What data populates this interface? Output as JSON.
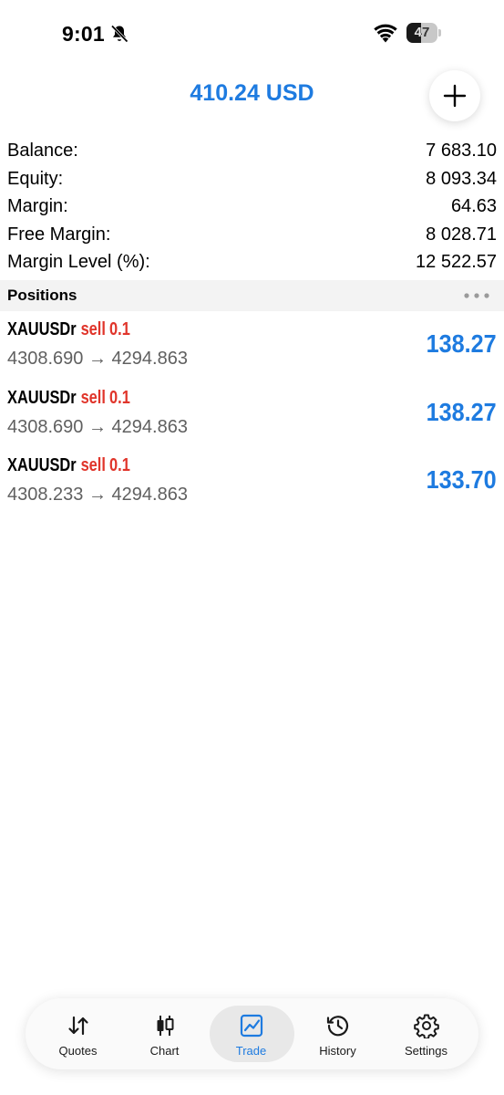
{
  "status_bar": {
    "time": "9:01",
    "battery": "47",
    "battery_level": 0.47
  },
  "header": {
    "title": "410.24 USD"
  },
  "account": [
    {
      "label": "Balance:",
      "value": "7 683.10"
    },
    {
      "label": "Equity:",
      "value": "8 093.34"
    },
    {
      "label": "Margin:",
      "value": "64.63"
    },
    {
      "label": "Free Margin:",
      "value": "8 028.71"
    },
    {
      "label": "Margin Level (%):",
      "value": "12 522.57"
    }
  ],
  "positions_section": {
    "title": "Positions"
  },
  "positions": [
    {
      "symbol": "XAUUSDr",
      "side": "sell",
      "volume": "0.1",
      "prices": "4308.690 → 4294.863",
      "profit": "138.27"
    },
    {
      "symbol": "XAUUSDr",
      "side": "sell",
      "volume": "0.1",
      "prices": "4308.690 → 4294.863",
      "profit": "138.27"
    },
    {
      "symbol": "XAUUSDr",
      "side": "sell",
      "volume": "0.1",
      "prices": "4308.233 → 4294.863",
      "profit": "133.70"
    }
  ],
  "tabs": [
    {
      "label": "Quotes",
      "icon": "quotes-icon"
    },
    {
      "label": "Chart",
      "icon": "chart-icon"
    },
    {
      "label": "Trade",
      "icon": "trade-icon",
      "active": true
    },
    {
      "label": "History",
      "icon": "history-icon"
    },
    {
      "label": "Settings",
      "icon": "settings-icon"
    }
  ],
  "colors": {
    "accent": "#1e7be0",
    "sell": "#e0352b"
  }
}
